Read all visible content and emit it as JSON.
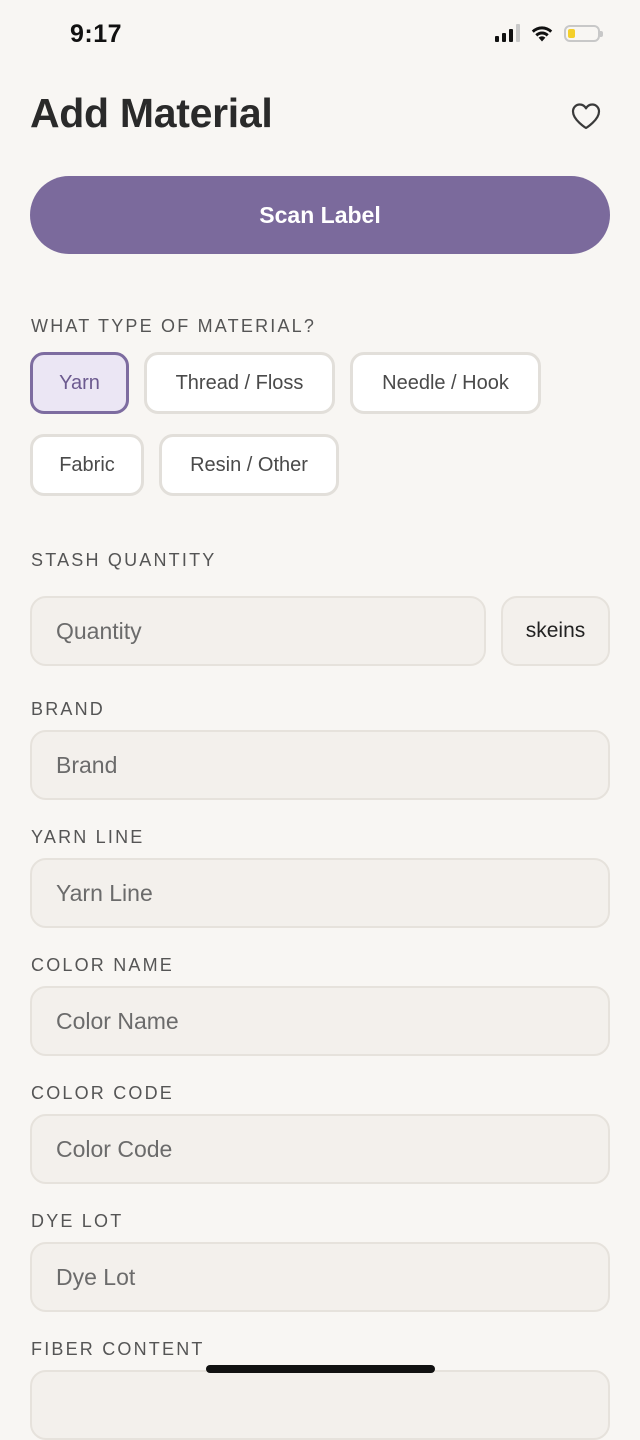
{
  "status_bar": {
    "time": "9:17",
    "battery_level": 0.25,
    "battery_color": "#f4cf2a"
  },
  "header": {
    "title": "Add Material",
    "favorite_icon": "heart-outline-icon"
  },
  "scan_button": {
    "label": "Scan Label",
    "color": "#7b6a9c"
  },
  "material_type": {
    "label": "WHAT TYPE OF MATERIAL?",
    "options": [
      "Yarn",
      "Thread / Floss",
      "Needle / Hook",
      "Fabric",
      "Resin / Other"
    ],
    "selected": "Yarn"
  },
  "stash_quantity": {
    "label": "STASH QUANTITY",
    "placeholder": "Quantity",
    "unit": "skeins"
  },
  "brand": {
    "label": "BRAND",
    "placeholder": "Brand"
  },
  "yarn_line": {
    "label": "YARN LINE",
    "placeholder": "Yarn Line"
  },
  "color_name": {
    "label": "COLOR NAME",
    "placeholder": "Color Name"
  },
  "color_code": {
    "label": "COLOR CODE",
    "placeholder": "Color Code"
  },
  "dye_lot": {
    "label": "DYE LOT",
    "placeholder": "Dye Lot"
  },
  "fiber_content": {
    "label": "FIBER CONTENT"
  }
}
